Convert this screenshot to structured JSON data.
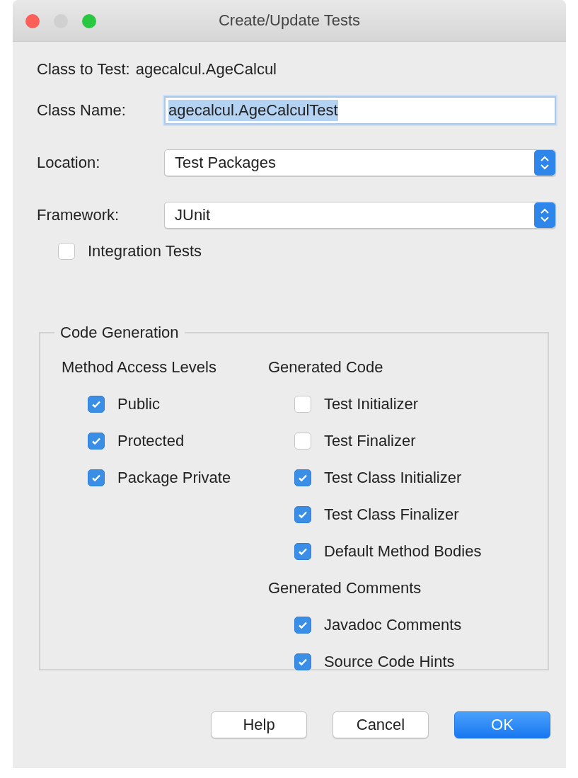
{
  "window": {
    "title": "Create/Update Tests"
  },
  "class_to_test": {
    "label": "Class to Test:",
    "value": "agecalcul.AgeCalcul"
  },
  "class_name": {
    "label": "Class Name:",
    "value": "agecalcul.AgeCalculTest",
    "text_selected": true
  },
  "location": {
    "label": "Location:",
    "value": "Test Packages"
  },
  "framework": {
    "label": "Framework:",
    "value": "JUnit"
  },
  "integration_tests": {
    "label": "Integration Tests",
    "checked": false
  },
  "code_generation": {
    "title": "Code Generation",
    "columns": [
      {
        "sections": [
          {
            "heading": "Method Access Levels",
            "options": [
              {
                "label": "Public",
                "checked": true
              },
              {
                "label": "Protected",
                "checked": true
              },
              {
                "label": "Package Private",
                "checked": true
              }
            ]
          }
        ]
      },
      {
        "sections": [
          {
            "heading": "Generated Code",
            "options": [
              {
                "label": "Test Initializer",
                "checked": false
              },
              {
                "label": "Test Finalizer",
                "checked": false
              },
              {
                "label": "Test Class Initializer",
                "checked": true
              },
              {
                "label": "Test Class Finalizer",
                "checked": true
              },
              {
                "label": "Default Method Bodies",
                "checked": true
              }
            ]
          },
          {
            "heading": "Generated Comments",
            "options": [
              {
                "label": "Javadoc Comments",
                "checked": true
              },
              {
                "label": "Source Code Hints",
                "checked": true
              }
            ]
          }
        ]
      }
    ]
  },
  "buttons": [
    {
      "label": "Help",
      "kind": "default"
    },
    {
      "label": "Cancel",
      "kind": "default"
    },
    {
      "label": "OK",
      "kind": "primary"
    }
  ]
}
